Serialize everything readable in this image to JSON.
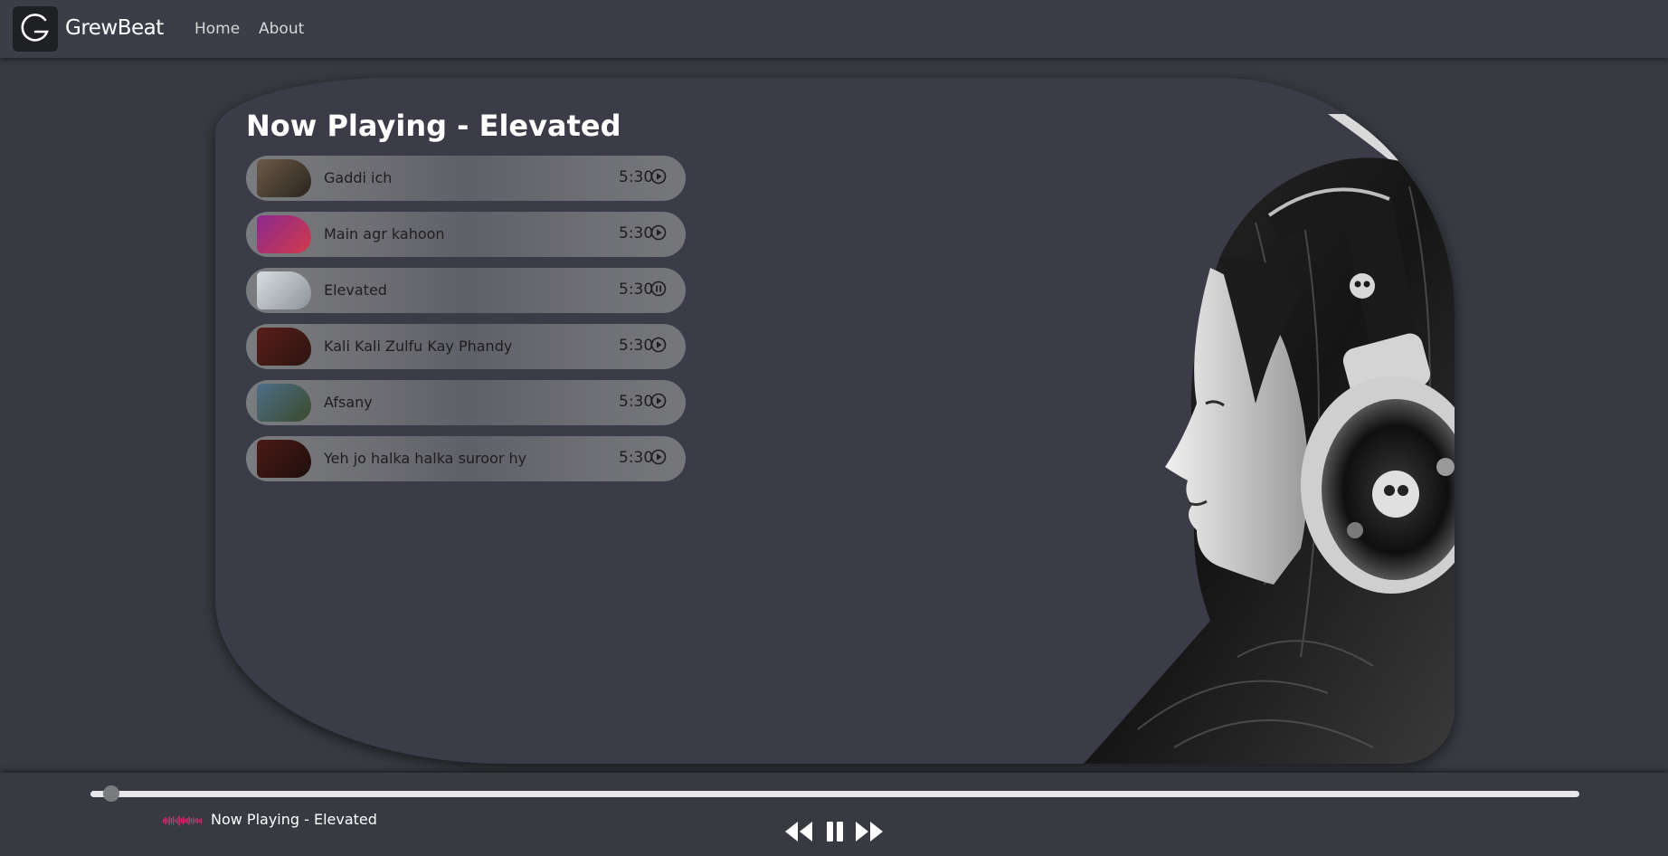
{
  "app": {
    "brand": "GrewBeat",
    "logo_letter": "G"
  },
  "nav": {
    "items": [
      {
        "label": "Home"
      },
      {
        "label": "About"
      }
    ]
  },
  "main": {
    "title": "Now Playing - Elevated",
    "songs": [
      {
        "name": "Gaddi ich",
        "duration": "5:30",
        "state": "play",
        "thumb_colors": [
          "#6b5a48",
          "#2a241d"
        ]
      },
      {
        "name": "Main agr kahoon",
        "duration": "5:30",
        "state": "play",
        "thumb_colors": [
          "#8a2a8e",
          "#d23a4a"
        ]
      },
      {
        "name": "Elevated",
        "duration": "5:30",
        "state": "pause",
        "thumb_colors": [
          "#d8dde0",
          "#8c939a"
        ]
      },
      {
        "name": "Kali Kali Zulfu Kay Phandy",
        "duration": "5:30",
        "state": "play",
        "thumb_colors": [
          "#5a1e1a",
          "#2b1410"
        ]
      },
      {
        "name": "Afsany",
        "duration": "5:30",
        "state": "play",
        "thumb_colors": [
          "#4e6e8a",
          "#3a4a2a"
        ]
      },
      {
        "name": "Yeh jo halka halka suroor hy",
        "duration": "5:30",
        "state": "play",
        "thumb_colors": [
          "#4a1a16",
          "#1e0e0c"
        ]
      }
    ]
  },
  "player": {
    "now_playing": "Now Playing - Elevated",
    "progress": 0.01,
    "accent_color": "#e0317a"
  },
  "icons": {
    "prev": "backward-icon",
    "pause": "pause-icon",
    "next": "forward-icon"
  }
}
